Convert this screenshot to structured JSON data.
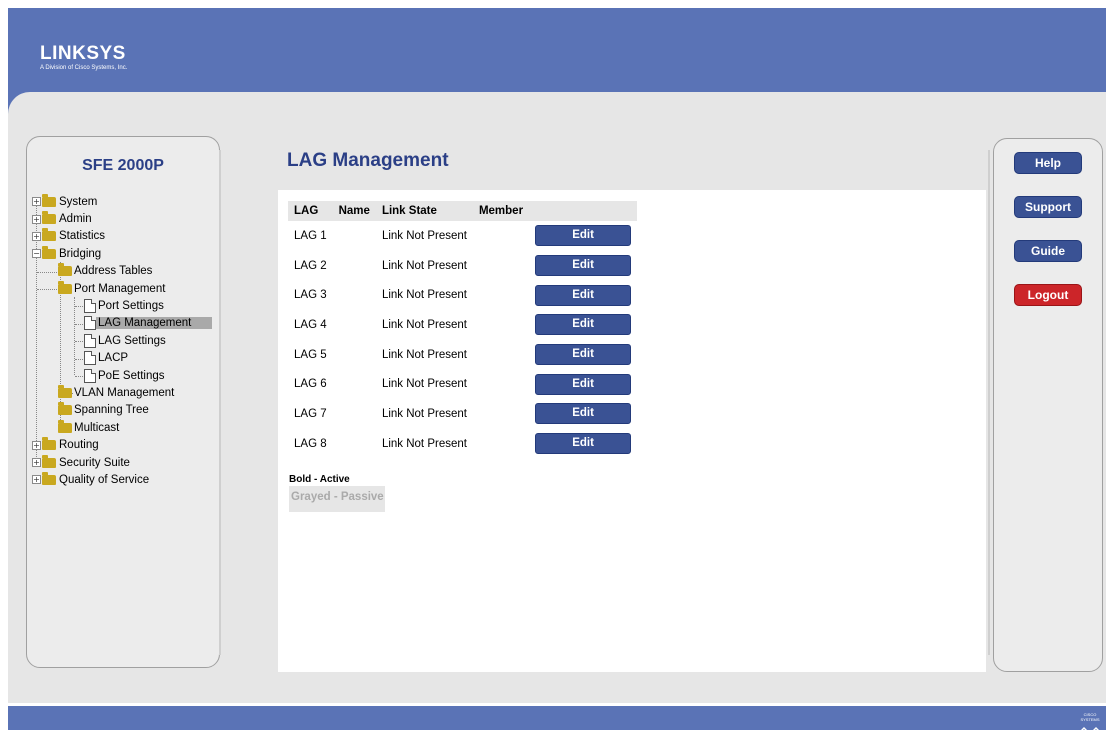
{
  "brand": {
    "logo": "LINKSYS",
    "tagline": "A Division of Cisco Systems, Inc.",
    "footer_mark": "CISCO SYSTEMS"
  },
  "nav": {
    "device": "SFE 2000P",
    "items": [
      {
        "label": "System"
      },
      {
        "label": "Admin"
      },
      {
        "label": "Statistics"
      },
      {
        "label": "Bridging"
      },
      {
        "label": "Address Tables"
      },
      {
        "label": "Port Management"
      },
      {
        "label": "Port Settings"
      },
      {
        "label": "LAG Management"
      },
      {
        "label": "LAG Settings"
      },
      {
        "label": "LACP"
      },
      {
        "label": "PoE Settings"
      },
      {
        "label": "VLAN Management"
      },
      {
        "label": "Spanning Tree"
      },
      {
        "label": "Multicast"
      },
      {
        "label": "Routing"
      },
      {
        "label": "Security Suite"
      },
      {
        "label": "Quality of Service"
      }
    ]
  },
  "page": {
    "title": "LAG Management",
    "columns": [
      "LAG",
      "Name",
      "Link State",
      "Member"
    ],
    "rows": [
      {
        "lag": "LAG 1",
        "name": "",
        "state": "Link Not Present",
        "member": "",
        "action": "Edit"
      },
      {
        "lag": "LAG 2",
        "name": "",
        "state": "Link Not Present",
        "member": "",
        "action": "Edit"
      },
      {
        "lag": "LAG 3",
        "name": "",
        "state": "Link Not Present",
        "member": "",
        "action": "Edit"
      },
      {
        "lag": "LAG 4",
        "name": "",
        "state": "Link Not Present",
        "member": "",
        "action": "Edit"
      },
      {
        "lag": "LAG 5",
        "name": "",
        "state": "Link Not Present",
        "member": "",
        "action": "Edit"
      },
      {
        "lag": "LAG 6",
        "name": "",
        "state": "Link Not Present",
        "member": "",
        "action": "Edit"
      },
      {
        "lag": "LAG 7",
        "name": "",
        "state": "Link Not Present",
        "member": "",
        "action": "Edit"
      },
      {
        "lag": "LAG 8",
        "name": "",
        "state": "Link Not Present",
        "member": "",
        "action": "Edit"
      }
    ],
    "legend_active": "Bold - Active",
    "legend_passive": "Grayed - Passive"
  },
  "side": {
    "help": "Help",
    "support": "Support",
    "guide": "Guide",
    "logout": "Logout"
  },
  "colors": {
    "header_blue": "#5a73b6",
    "button_blue": "#3a5294",
    "logout_red": "#cc2529",
    "title_blue": "#2b3f86"
  }
}
